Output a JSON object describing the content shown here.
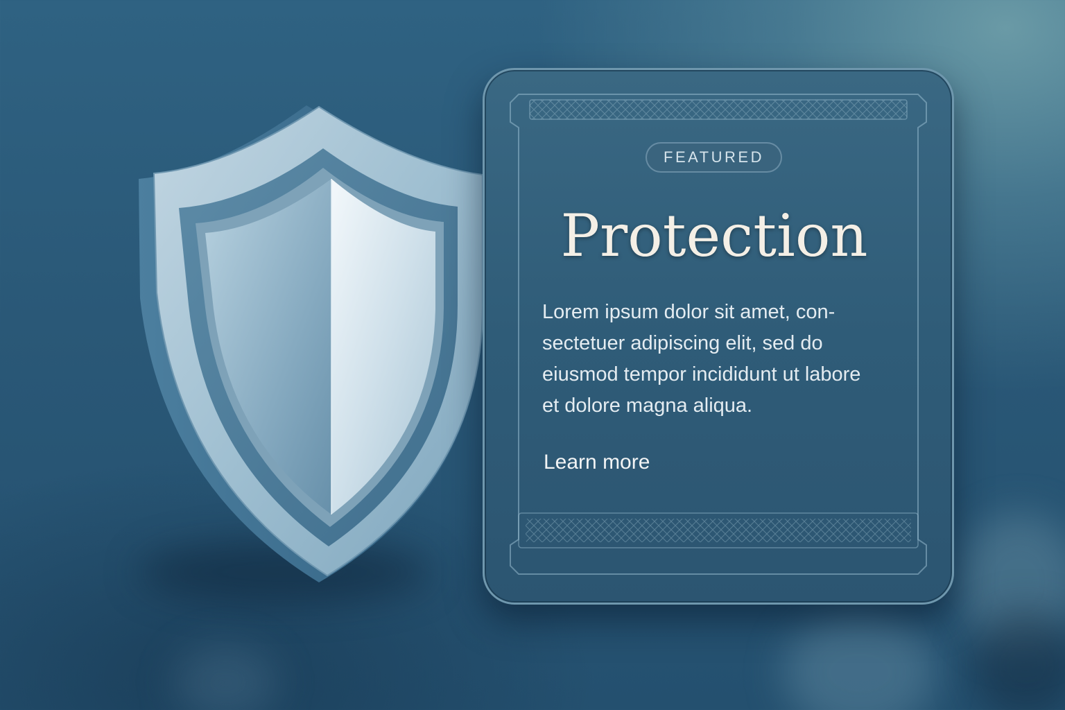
{
  "card": {
    "badge": "FEATURED",
    "title": "Protection",
    "body": "Lorem ipsum dolor sit amet, con-\nsectetuer adipiscing elit, sed do\neiusmod tempor incididunt ut labore\net dolore magna aliqua.",
    "link": "Learn more"
  },
  "icons": {
    "shield": "shield-icon"
  },
  "colors": {
    "background": "#2a5877",
    "card": "#315e7a",
    "title": "#f4efe6",
    "shield_silver": "#b7cfdc"
  }
}
